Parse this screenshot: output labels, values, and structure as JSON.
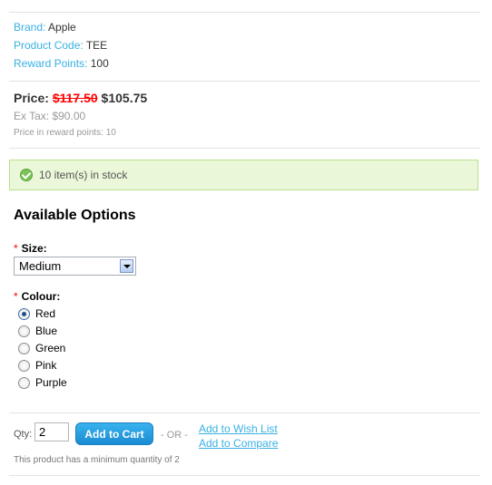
{
  "info": [
    {
      "key": "Brand:",
      "value": "Apple"
    },
    {
      "key": "Product Code:",
      "value": "TEE"
    },
    {
      "key": "Reward Points:",
      "value": "100"
    }
  ],
  "price": {
    "label": "Price:",
    "old": "$117.50",
    "new": "$105.75",
    "ex_tax": "Ex Tax: $90.00",
    "reward": "Price in reward points: 10"
  },
  "stock": {
    "text": "10 item(s) in stock"
  },
  "options": {
    "title": "Available Options",
    "required_mark": "*",
    "size_label": "Size:",
    "size_value": "Medium",
    "colour_label": "Colour:",
    "colours": [
      "Red",
      "Blue",
      "Green",
      "Pink",
      "Purple"
    ],
    "selected_colour": "Red"
  },
  "cart": {
    "qty_label": "Qty:",
    "qty_value": "2",
    "add_button": "Add to Cart",
    "or_text": "- OR -",
    "wishlist": "Add to Wish List",
    "compare": "Add to Compare",
    "min_note": "This product has a minimum quantity of 2"
  },
  "colors": {
    "accent": "#38b0e3",
    "price_old": "#ff0000",
    "stock_bg": "#eaf7d9"
  }
}
